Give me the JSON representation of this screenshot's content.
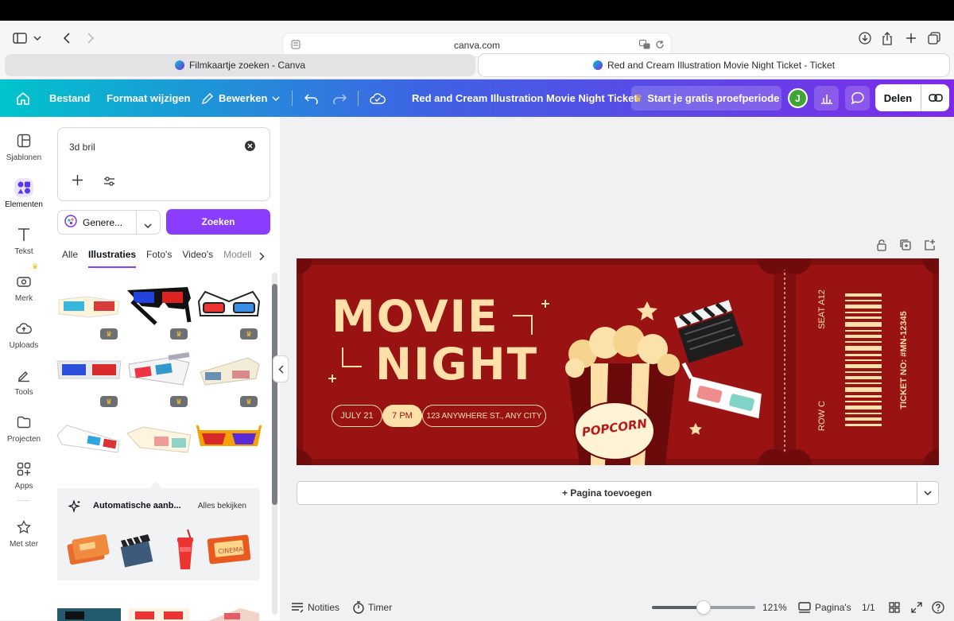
{
  "browser": {
    "url": "canva.com",
    "tabs": [
      {
        "title": "Filmkaartje zoeken - Canva",
        "active": false
      },
      {
        "title": "Red and Cream Illustration Movie Night Ticket - Ticket",
        "active": true
      }
    ]
  },
  "toolbar": {
    "file": "Bestand",
    "resize": "Formaat wijzigen",
    "edit": "Bewerken",
    "doc_title": "Red and Cream Illustration Movie Night Ticket",
    "trial": "Start je gratis proefperiode",
    "avatar": "J",
    "share": "Delen"
  },
  "rail": {
    "items": [
      "Sjablonen",
      "Elementen",
      "Tekst",
      "Merk",
      "Uploads",
      "Tools",
      "Projecten",
      "Apps",
      "Met ster"
    ]
  },
  "panel": {
    "search_value": "3d bril",
    "generate": "Genere...",
    "search_button": "Zoeken",
    "tabs": [
      "Alle",
      "Illustraties",
      "Foto's",
      "Video's",
      "Modell"
    ],
    "auto_title": "Automatische aanb...",
    "see_all": "Alles bekijken"
  },
  "ticket": {
    "title1": "MOVIE",
    "title2": "NIGHT",
    "date": "JULY 21",
    "time": "7 PM",
    "address": "123 ANYWHERE ST., ANY CITY",
    "popcorn": "POPCORN",
    "seat": "SEAT A12",
    "row": "ROW C",
    "ticket_no": "TICKET NO: #MN-12345",
    "colors": {
      "red": "#8d1111",
      "cream": "#ffe0a8",
      "dark": "#6f0b0b"
    }
  },
  "canvas": {
    "add_page": "+ Pagina toevoegen"
  },
  "footer": {
    "notes": "Notities",
    "timer": "Timer",
    "zoom": "121%",
    "zoom_level": 0.5,
    "pages": "Pagina's",
    "page_count": "1/1"
  }
}
